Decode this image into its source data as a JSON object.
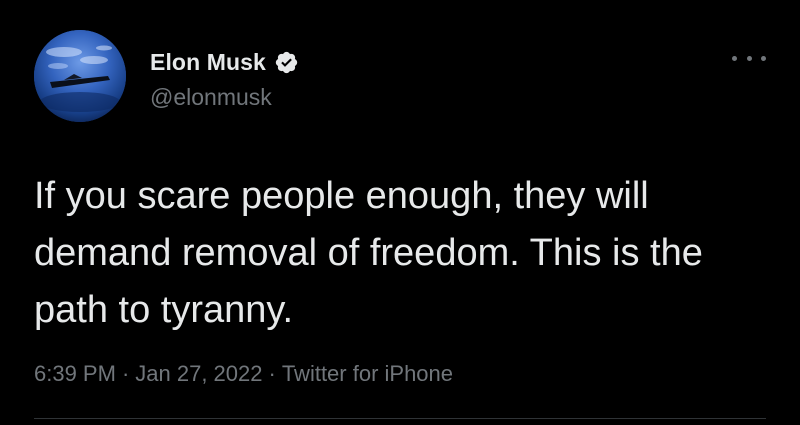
{
  "tweet": {
    "author": {
      "display_name": "Elon Musk",
      "handle": "@elonmusk",
      "verified": true,
      "avatar_icon": "avatar-space-image"
    },
    "more_icon": "more-options-icon",
    "text": "If you scare people enough, they will demand removal of freedom. This is the path to tyranny.",
    "meta": {
      "time": "6:39 PM",
      "separator": "·",
      "date": "Jan 27, 2022",
      "source": "Twitter for iPhone"
    }
  },
  "colors": {
    "background": "#000000",
    "primary_text": "#e7e9ea",
    "secondary_text": "#71767b",
    "verified_badge": "#e7e9ea",
    "divider": "#2f3336"
  }
}
